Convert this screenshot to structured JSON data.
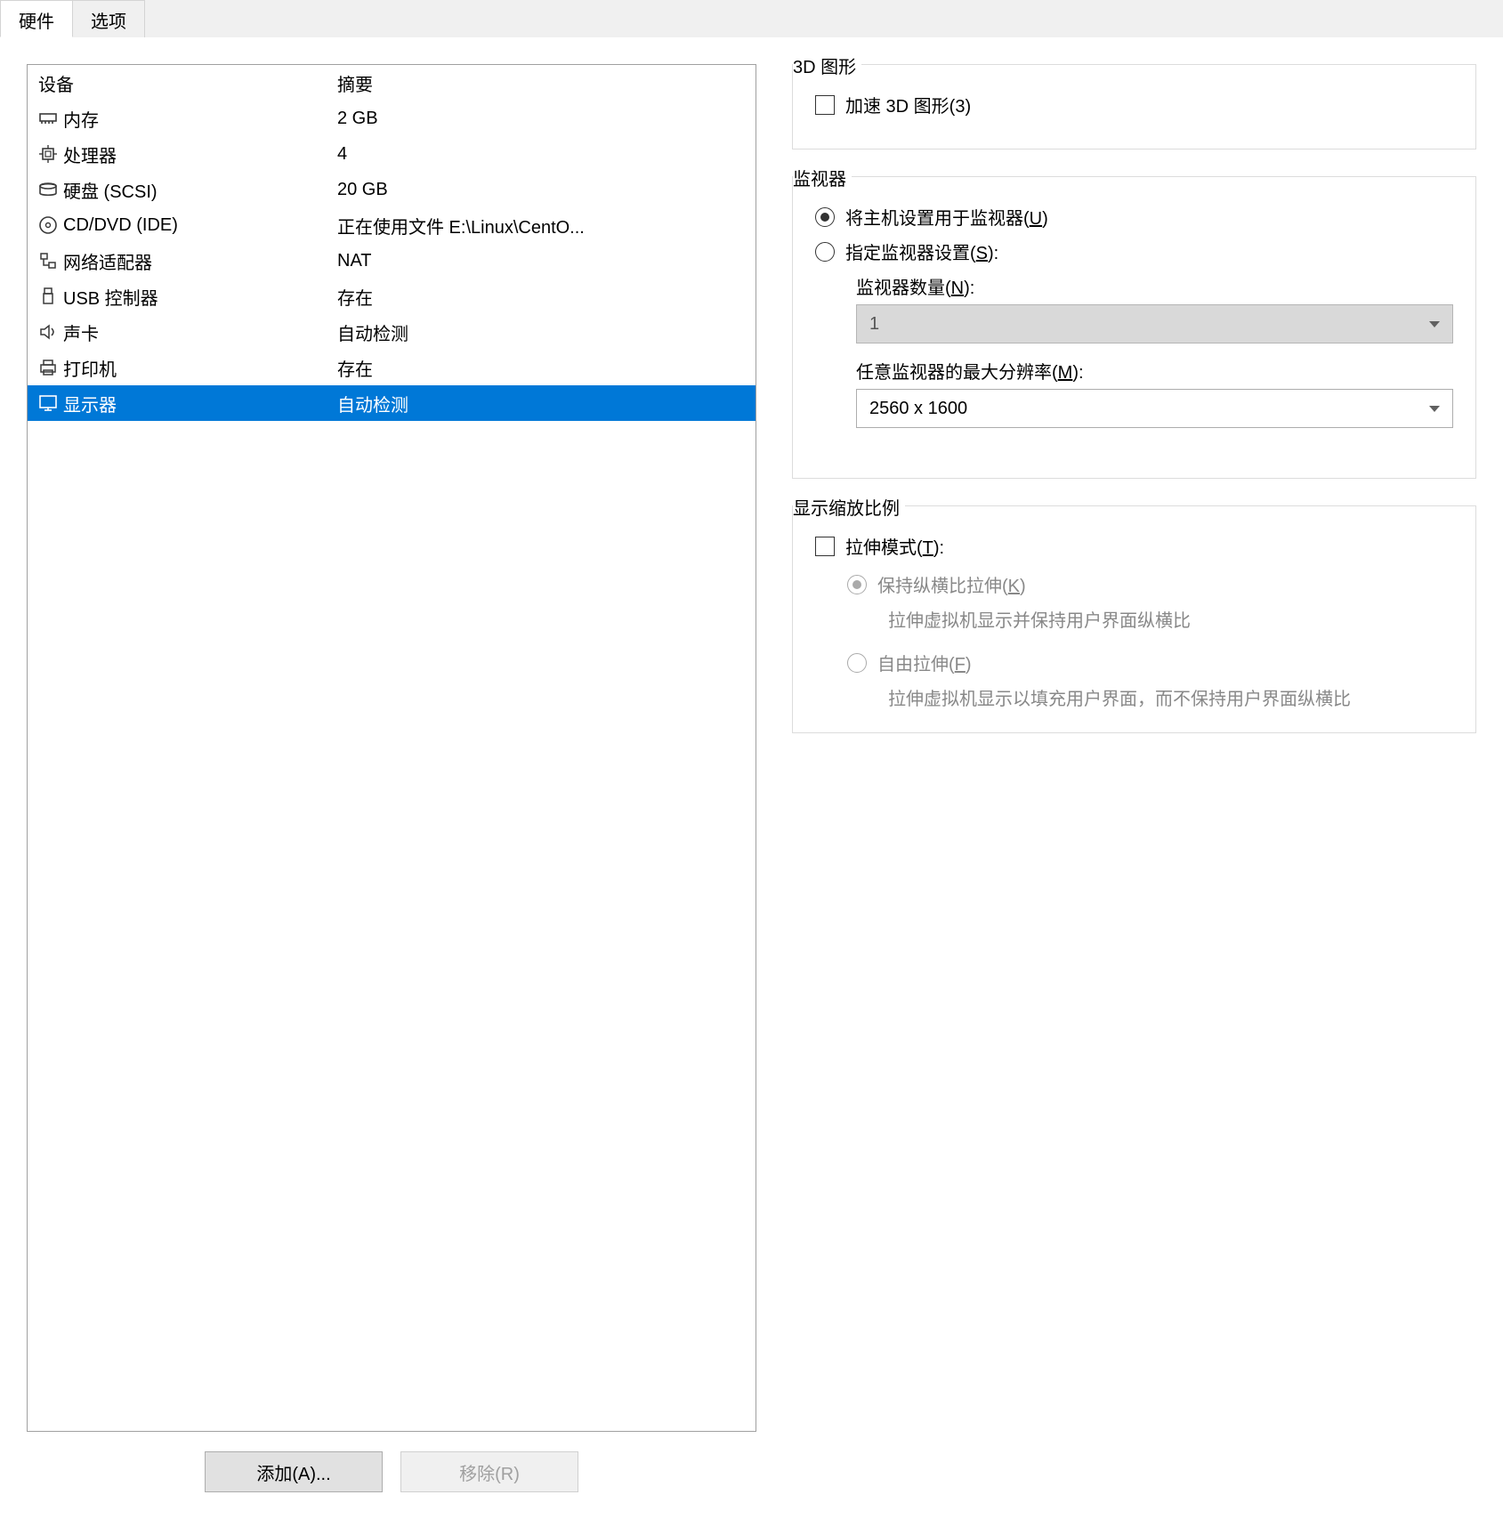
{
  "tabs": {
    "hardware": "硬件",
    "options": "选项"
  },
  "headers": {
    "device": "设备",
    "summary": "摘要"
  },
  "devices": [
    {
      "icon": "memory",
      "name": "内存",
      "summary": "2 GB"
    },
    {
      "icon": "cpu",
      "name": "处理器",
      "summary": "4"
    },
    {
      "icon": "disk",
      "name": "硬盘 (SCSI)",
      "summary": "20 GB"
    },
    {
      "icon": "cd",
      "name": "CD/DVD (IDE)",
      "summary": "正在使用文件 E:\\Linux\\CentO..."
    },
    {
      "icon": "net",
      "name": "网络适配器",
      "summary": "NAT"
    },
    {
      "icon": "usb",
      "name": "USB 控制器",
      "summary": "存在"
    },
    {
      "icon": "sound",
      "name": "声卡",
      "summary": "自动检测"
    },
    {
      "icon": "printer",
      "name": "打印机",
      "summary": "存在"
    },
    {
      "icon": "display",
      "name": "显示器",
      "summary": "自动检测",
      "selected": true
    }
  ],
  "buttons": {
    "add": "添加(A)...",
    "remove": "移除(R)"
  },
  "group_3d": {
    "title": "3D 图形",
    "accel": "加速 3D 图形(3)"
  },
  "group_monitor": {
    "title": "监视器",
    "use_host_pre": "将主机设置用于监视器(",
    "use_host_u": "U",
    "use_host_post": ")",
    "specify_pre": "指定监视器设置(",
    "specify_u": "S",
    "specify_post": "):",
    "count_pre": "监视器数量(",
    "count_u": "N",
    "count_post": "):",
    "count_value": "1",
    "maxres_pre": "任意监视器的最大分辨率(",
    "maxres_u": "M",
    "maxres_post": "):",
    "maxres_value": "2560 x 1600"
  },
  "group_scaling": {
    "title": "显示缩放比例",
    "stretch_pre": "拉伸模式(",
    "stretch_u": "T",
    "stretch_post": "):",
    "keep_pre": "保持纵横比拉伸(",
    "keep_u": "K",
    "keep_post": ")",
    "keep_desc": "拉伸虚拟机显示并保持用户界面纵横比",
    "free_pre": "自由拉伸(",
    "free_u": "F",
    "free_post": ")",
    "free_desc": "拉伸虚拟机显示以填充用户界面，而不保持用户界面纵横比"
  }
}
